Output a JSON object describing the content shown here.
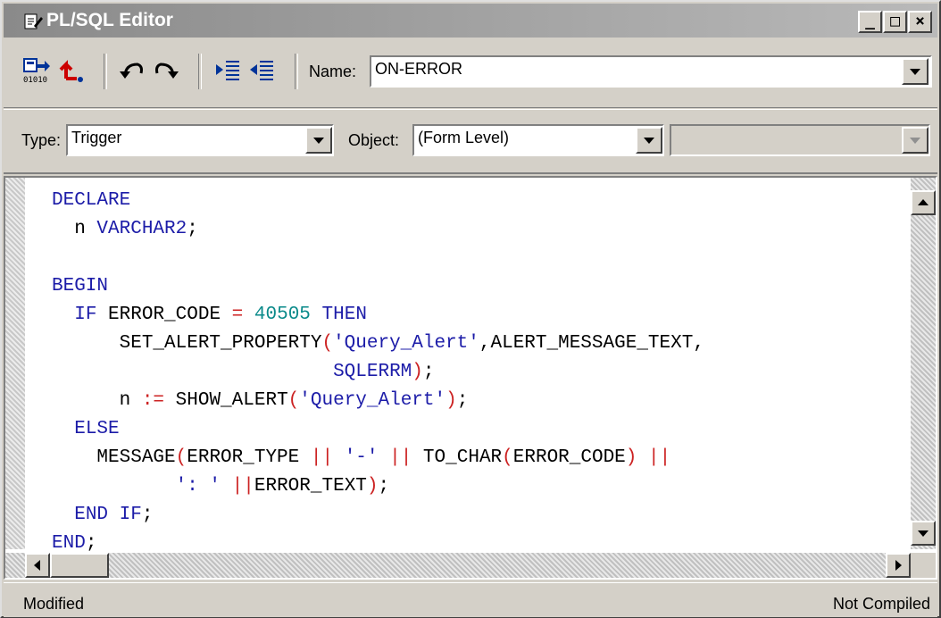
{
  "window": {
    "title": "PL/SQL Editor",
    "minimize": "_",
    "maximize": "□",
    "close": "×"
  },
  "toolbar": {
    "name_label": "Name:",
    "name_value": "ON-ERROR"
  },
  "filter": {
    "type_label": "Type:",
    "type_value": "Trigger",
    "object_label": "Object:",
    "object_value": "(Form Level)",
    "object2_value": ""
  },
  "code_lines": [
    "DECLARE",
    "  n VARCHAR2;",
    "",
    "BEGIN",
    "  IF ERROR_CODE = 40505 THEN",
    "      SET_ALERT_PROPERTY('Query_Alert',ALERT_MESSAGE_TEXT,",
    "                         SQLERRM);",
    "      n := SHOW_ALERT('Query_Alert');",
    "  ELSE",
    "    MESSAGE(ERROR_TYPE || '-' || TO_CHAR(ERROR_CODE) ||",
    "           ': ' ||ERROR_TEXT);",
    "  END IF;",
    "END;"
  ],
  "status": {
    "left": "Modified",
    "right": "Not Compiled"
  },
  "colors": {
    "keyword": "#1c1ca8",
    "number": "#0a8a8a",
    "operator": "#cc2222",
    "title_bar": "#8a8a8a"
  }
}
